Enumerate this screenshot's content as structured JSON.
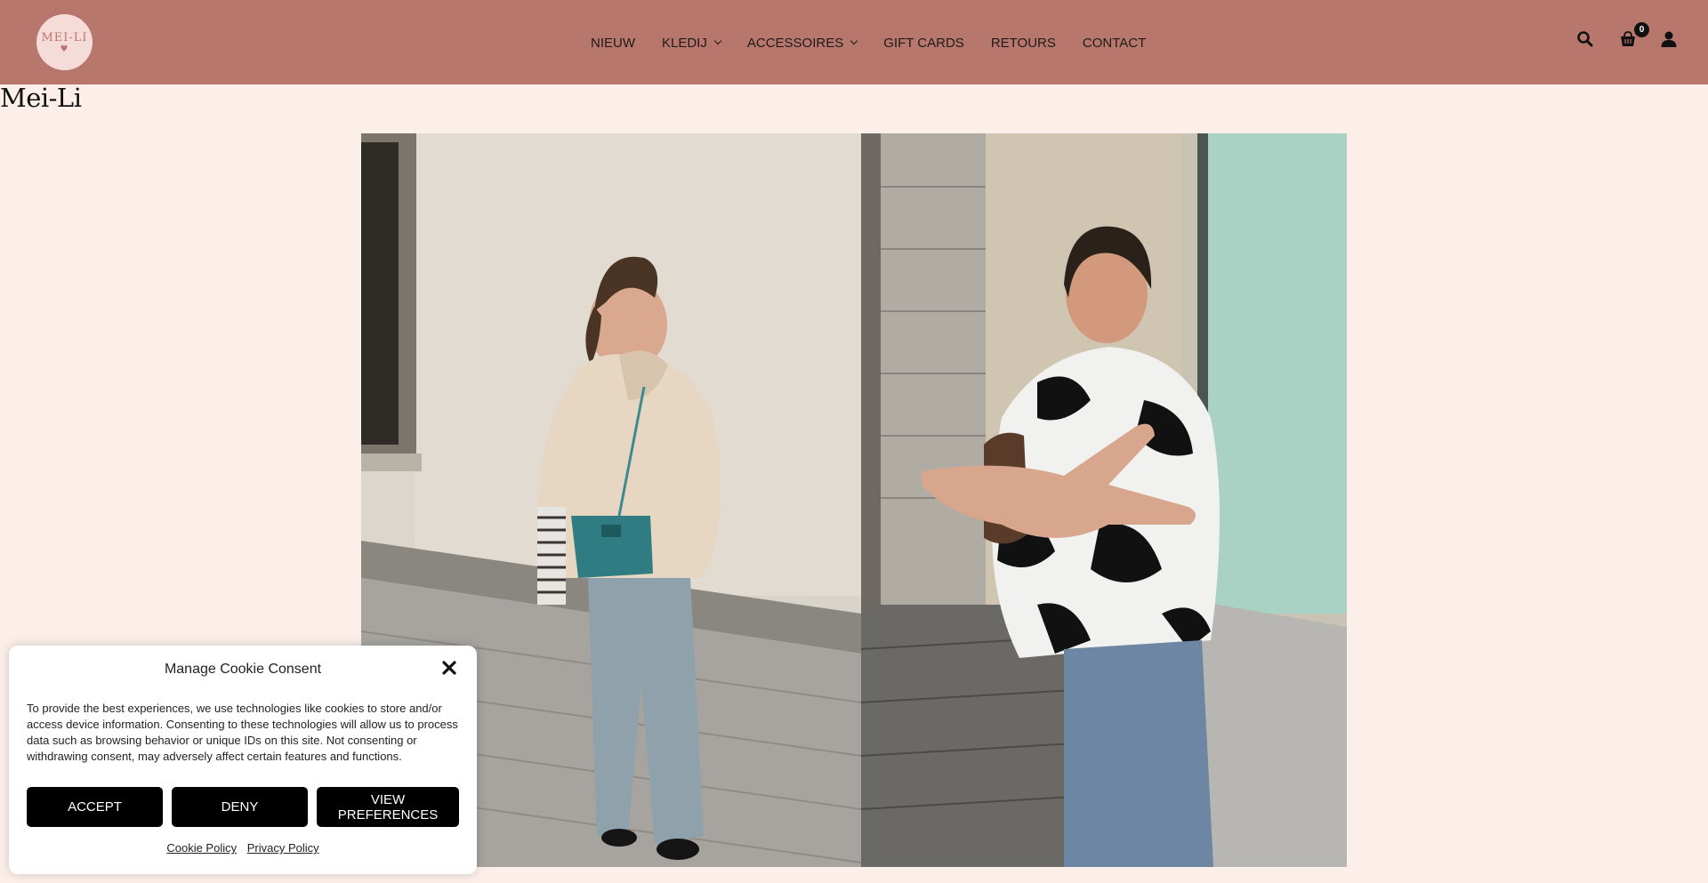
{
  "header": {
    "logo_text": "MEI-LI",
    "nav": [
      {
        "label": "NIEUW",
        "dropdown": false
      },
      {
        "label": "KLEDIJ",
        "dropdown": true
      },
      {
        "label": "ACCESSOIRES",
        "dropdown": true
      },
      {
        "label": "GIFT CARDS",
        "dropdown": false
      },
      {
        "label": "RETOURS",
        "dropdown": false
      },
      {
        "label": "CONTACT",
        "dropdown": false
      }
    ],
    "cart_count": "0",
    "icons": [
      "search-icon",
      "cart-icon",
      "account-icon"
    ],
    "background_color": "#b8776c"
  },
  "page": {
    "title": "Mei-Li",
    "background_color": "#fcefe9"
  },
  "cookie": {
    "title": "Manage Cookie Consent",
    "text": "To provide the best experiences, we use technologies like cookies to store and/or access device information. Consenting to these technologies will allow us to process data such as browsing behavior or unique IDs on this site. Not consenting or withdrawing consent, may adversely affect certain features and functions.",
    "accept_label": "ACCEPT",
    "deny_label": "DENY",
    "preferences_label": "VIEW PREFERENCES",
    "cookie_policy_label": "Cookie Policy",
    "privacy_policy_label": "Privacy Policy"
  }
}
